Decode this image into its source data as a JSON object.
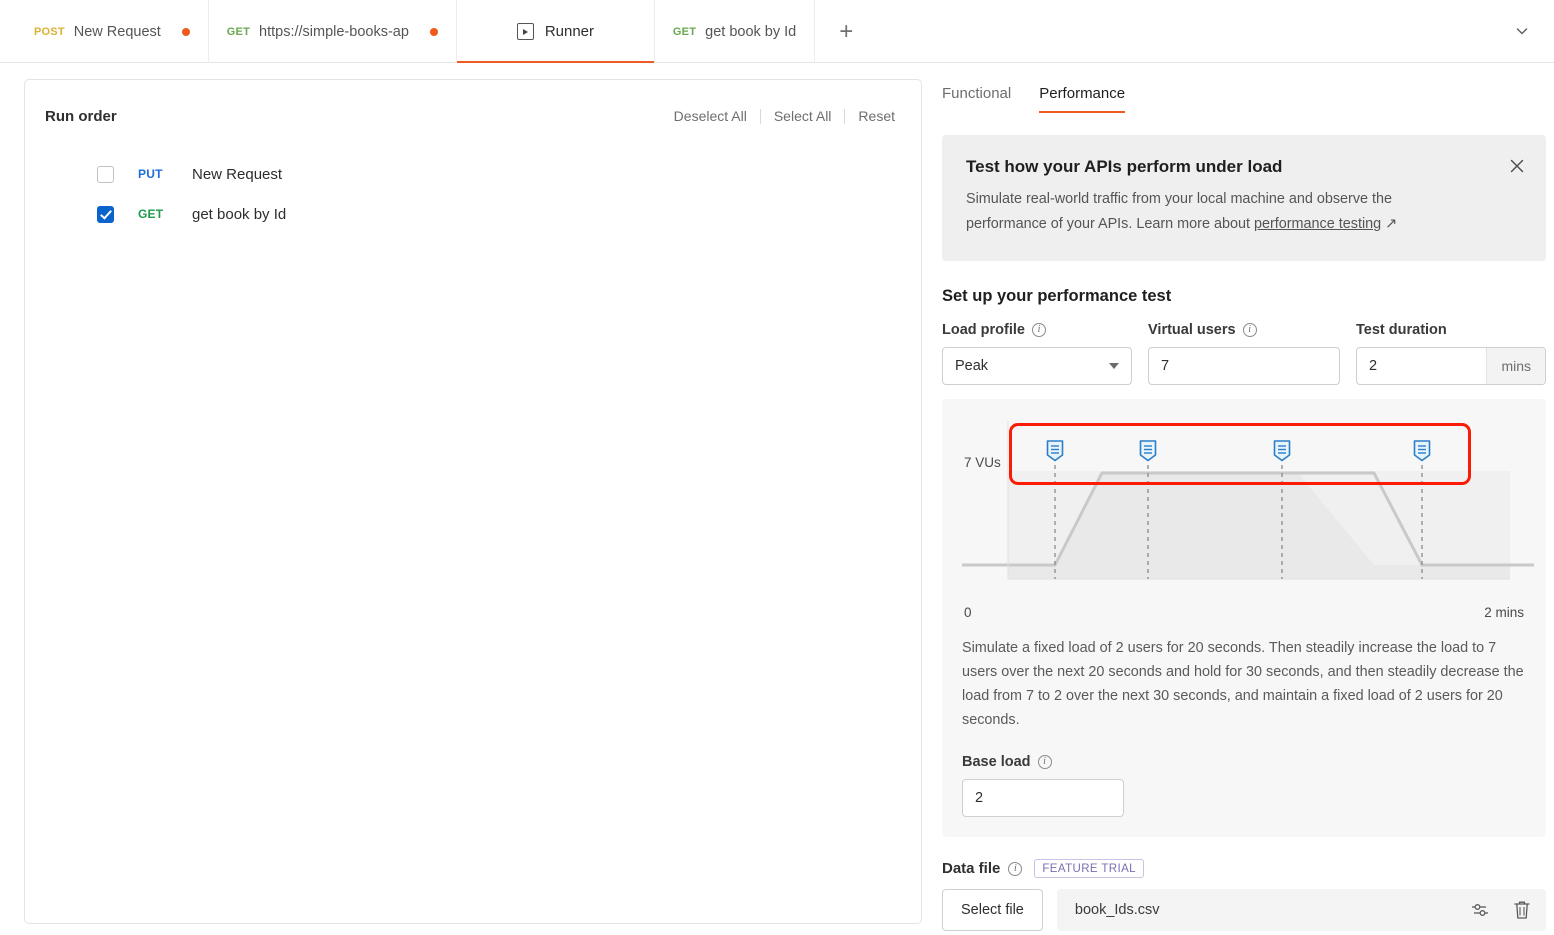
{
  "tabbar": {
    "tabs": [
      {
        "method": "POST",
        "method_class": "m-post",
        "name": "New Request",
        "dirty": true
      },
      {
        "method": "GET",
        "method_class": "m-get",
        "name": "https://simple-books-ap",
        "dirty": true
      },
      {
        "method": "",
        "method_class": "",
        "name": "Runner",
        "dirty": false
      },
      {
        "method": "GET",
        "method_class": "m-get",
        "name": "get book by Id",
        "dirty": false
      }
    ],
    "new_tab_label": "+",
    "collapse_icon": "chevron-down-icon"
  },
  "run_order": {
    "title": "Run order",
    "actions": [
      "Deselect All",
      "Select All",
      "Reset"
    ],
    "items": [
      {
        "checked": false,
        "method": "PUT",
        "method_class": "put",
        "name": "New Request"
      },
      {
        "checked": true,
        "method": "GET",
        "method_class": "get",
        "name": "get book by Id"
      }
    ]
  },
  "right": {
    "tabs": [
      {
        "label": "Functional",
        "active": false
      },
      {
        "label": "Performance",
        "active": true
      }
    ],
    "banner": {
      "title": "Test how your APIs perform under load",
      "body_before": "Simulate real-world traffic from your local machine and observe the performance of your APIs. Learn more about ",
      "link": "performance testing",
      "link_arrow": "↗",
      "close_icon": "close-icon"
    },
    "setup": {
      "title": "Set up your performance test",
      "load_profile": {
        "label": "Load profile",
        "value": "Peak"
      },
      "virtual_users": {
        "label": "Virtual users",
        "value": "7"
      },
      "test_duration": {
        "label": "Test duration",
        "value": "2",
        "unit": "mins"
      },
      "base_load": {
        "label": "Base load",
        "value": "2"
      },
      "description": "Simulate a fixed load of 2 users for 20 seconds. Then steadily increase the load to 7 users over the next 20 seconds and hold for 30 seconds, and then steadily decrease the load from 7 to 2 over the next 30 seconds, and maintain a fixed load of 2 users for 20 seconds."
    },
    "data_file": {
      "label": "Data file",
      "badge": "FEATURE TRIAL",
      "select_button": "Select file",
      "file_name": "book_Ids.csv",
      "settings_icon": "sliders-icon",
      "delete_icon": "trash-icon"
    }
  },
  "chart_data": {
    "type": "area",
    "title": "",
    "xlabel": "",
    "ylabel": "",
    "y_max_label": "7 VUs",
    "x_start_label": "0",
    "x_end_label": "2 mins",
    "xlim": [
      0,
      120
    ],
    "ylim": [
      0,
      7
    ],
    "x": [
      0,
      20,
      40,
      70,
      100,
      120
    ],
    "values": [
      2,
      2,
      7,
      7,
      2,
      2
    ],
    "grid": false,
    "legend": "none",
    "markers": [
      {
        "x": 20,
        "icon": "stage-marker-icon"
      },
      {
        "x": 40,
        "icon": "stage-marker-icon"
      },
      {
        "x": 70,
        "icon": "stage-marker-icon"
      },
      {
        "x": 100,
        "icon": "stage-marker-icon"
      }
    ],
    "highlight_box": {
      "color": "#fb1c07",
      "covers": "stage markers row"
    }
  }
}
